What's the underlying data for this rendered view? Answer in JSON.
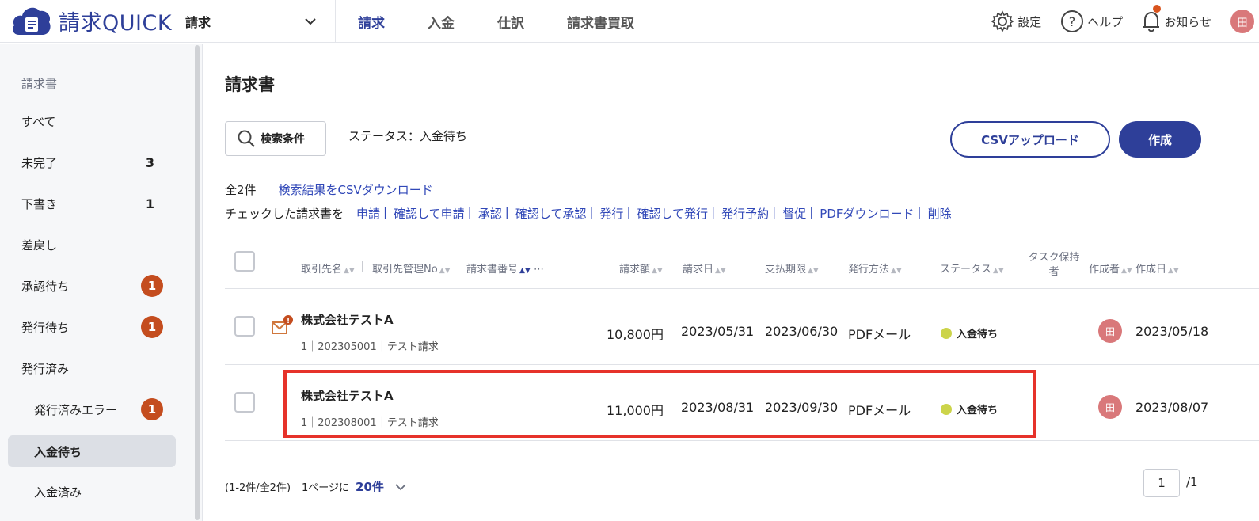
{
  "header": {
    "logo_text": "請求QUICK",
    "app_select": "請求",
    "nav": [
      "請求",
      "入金",
      "仕訳",
      "請求書買取"
    ],
    "active_nav": "請求",
    "settings_label": "設定",
    "help_label": "ヘルプ",
    "notice_label": "お知らせ",
    "avatar": "田"
  },
  "sidebar": {
    "heading": "請求書",
    "items": [
      {
        "label": "すべて"
      },
      {
        "label": "未完了",
        "count": "3"
      },
      {
        "label": "下書き",
        "count": "1"
      },
      {
        "label": "差戻し"
      },
      {
        "label": "承認待ち",
        "badge": "1"
      },
      {
        "label": "発行待ち",
        "badge": "1"
      },
      {
        "label": "発行済み"
      },
      {
        "label": "発行済みエラー",
        "badge": "1"
      },
      {
        "label": "入金待ち"
      },
      {
        "label": "入金済み"
      }
    ]
  },
  "main": {
    "title": "請求書",
    "search_label": "検索条件",
    "status_filter": "ステータス：入金待ち",
    "csv_upload": "CSVアップロード",
    "create": "作成",
    "total": "全2件",
    "csv_download": "検索結果をCSVダウンロード",
    "action_prefix": "チェックした請求書を",
    "actions": [
      "申請",
      "確認して申請",
      "承認",
      "確認して承認",
      "発行",
      "確認して発行",
      "発行予約",
      "督促",
      "PDFダウンロード",
      "削除"
    ],
    "columns": {
      "client": "取引先名",
      "client_no": "取引先管理No",
      "invoice_no": "請求書番号",
      "more": "⋯",
      "amount": "請求額",
      "invoice_date": "請求日",
      "due_date": "支払期限",
      "method": "発行方法",
      "status": "ステータス",
      "task_owner": "タスク保持者",
      "creator": "作成者",
      "created_date": "作成日"
    },
    "rows": [
      {
        "client": "株式会社テストA",
        "sub": "1｜202305001｜テスト請求",
        "amount": "10,800円",
        "invoice_date": "2023/05/31",
        "due_date": "2023/06/30",
        "method": "PDFメール",
        "status": "入金待ち",
        "creator": "田",
        "created": "2023/05/18"
      },
      {
        "client": "株式会社テストA",
        "sub": "1｜202308001｜テスト請求",
        "amount": "11,000円",
        "invoice_date": "2023/08/31",
        "due_date": "2023/09/30",
        "method": "PDFメール",
        "status": "入金待ち",
        "creator": "田",
        "created": "2023/08/07"
      }
    ],
    "footer": {
      "range": "(1-2件/全2件)",
      "per_page_label": "1ページに",
      "per_page": "20件",
      "page": "1",
      "page_total": "/1"
    }
  },
  "colors": {
    "brand": "#2e3f99",
    "badge": "#c44d1f",
    "highlight": "#e6322a"
  }
}
